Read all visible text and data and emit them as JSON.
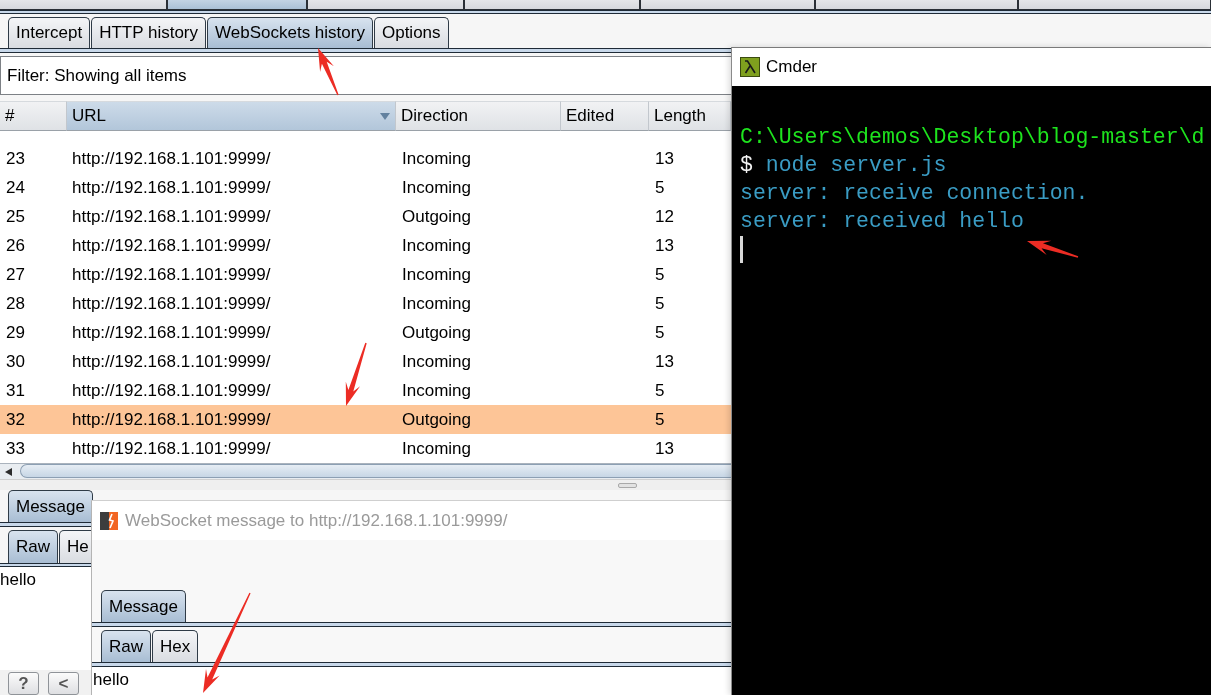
{
  "main_window": {
    "top_tabs": [
      {
        "selected": false
      },
      {
        "selected": true
      },
      {
        "selected": false
      },
      {
        "selected": false
      },
      {
        "selected": false
      },
      {
        "selected": false
      },
      {
        "selected": false
      }
    ],
    "sub_tabs": [
      {
        "label": "Intercept",
        "selected": false
      },
      {
        "label": "HTTP history",
        "selected": false
      },
      {
        "label": "WebSockets history",
        "selected": true
      },
      {
        "label": "Options",
        "selected": false
      }
    ],
    "filter": "Filter: Showing all items",
    "table": {
      "columns": [
        {
          "label": "#",
          "sorted": false
        },
        {
          "label": "URL",
          "sorted": true
        },
        {
          "label": "Direction",
          "sorted": false
        },
        {
          "label": "Edited",
          "sorted": false
        },
        {
          "label": "Length",
          "sorted": false
        }
      ],
      "rows": [
        {
          "number": "23",
          "url": "http://192.168.1.101:9999/",
          "direction": "Incoming",
          "length": "13",
          "selected": false
        },
        {
          "number": "24",
          "url": "http://192.168.1.101:9999/",
          "direction": "Incoming",
          "length": "5",
          "selected": false
        },
        {
          "number": "25",
          "url": "http://192.168.1.101:9999/",
          "direction": "Outgoing",
          "length": "12",
          "selected": false
        },
        {
          "number": "26",
          "url": "http://192.168.1.101:9999/",
          "direction": "Incoming",
          "length": "13",
          "selected": false
        },
        {
          "number": "27",
          "url": "http://192.168.1.101:9999/",
          "direction": "Incoming",
          "length": "5",
          "selected": false
        },
        {
          "number": "28",
          "url": "http://192.168.1.101:9999/",
          "direction": "Incoming",
          "length": "5",
          "selected": false
        },
        {
          "number": "29",
          "url": "http://192.168.1.101:9999/",
          "direction": "Outgoing",
          "length": "5",
          "selected": false
        },
        {
          "number": "30",
          "url": "http://192.168.1.101:9999/",
          "direction": "Incoming",
          "length": "13",
          "selected": false
        },
        {
          "number": "31",
          "url": "http://192.168.1.101:9999/",
          "direction": "Incoming",
          "length": "5",
          "selected": false
        },
        {
          "number": "32",
          "url": "http://192.168.1.101:9999/",
          "direction": "Outgoing",
          "length": "5",
          "selected": true
        },
        {
          "number": "33",
          "url": "http://192.168.1.101:9999/",
          "direction": "Incoming",
          "length": "13",
          "selected": false
        }
      ]
    },
    "message_tabs": [
      {
        "label": "Message",
        "selected": true
      }
    ],
    "view_tabs": [
      {
        "label": "Raw",
        "selected": true
      },
      {
        "label": "He",
        "selected": false
      }
    ],
    "body": "hello",
    "buttons": [
      "?",
      "<"
    ]
  },
  "message_dialog": {
    "title": "WebSocket message to http://192.168.1.101:9999/",
    "message_tabs": [
      {
        "label": "Message",
        "selected": true
      }
    ],
    "view_tabs": [
      {
        "label": "Raw",
        "selected": true
      },
      {
        "label": "Hex",
        "selected": false
      }
    ],
    "body": "hello"
  },
  "terminal": {
    "title": "Cmder",
    "lines": [
      {
        "kind": "path",
        "text": "C:\\Users\\demos\\Desktop\\blog-master\\d"
      },
      {
        "kind": "command",
        "prompt": "$",
        "text": "node server.js"
      },
      {
        "kind": "output",
        "text": "server: receive connection."
      },
      {
        "kind": "output",
        "text": "server: received hello"
      }
    ]
  }
}
